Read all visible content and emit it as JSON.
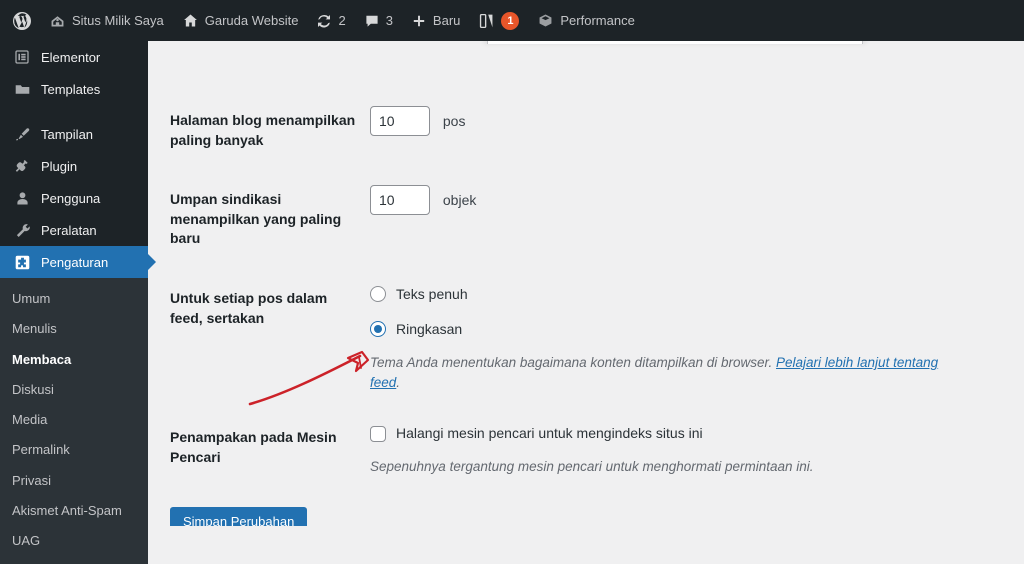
{
  "adminbar": {
    "items": [
      {
        "name": "wp-logo",
        "icon": "wordpress-icon",
        "label": ""
      },
      {
        "name": "my-site",
        "icon": "site-icon",
        "label": "Situs Milik Saya"
      },
      {
        "name": "site-name",
        "icon": "home-icon",
        "label": "Garuda Website"
      },
      {
        "name": "updates",
        "icon": "update-icon",
        "label": "2"
      },
      {
        "name": "comments",
        "icon": "comment-icon",
        "label": "3"
      },
      {
        "name": "new-content",
        "icon": "plus-icon",
        "label": "Baru"
      },
      {
        "name": "yoast-seo",
        "icon": "yoast-icon",
        "label": "",
        "badge": "1"
      },
      {
        "name": "performance",
        "icon": "performance-icon",
        "label": "Performance"
      }
    ]
  },
  "sidebar": {
    "top_items": [
      {
        "label": "Elementor",
        "icon": "elementor-icon",
        "current": false
      },
      {
        "label": "Templates",
        "icon": "folder-icon",
        "current": false
      },
      {
        "label": "Tampilan",
        "icon": "appearance-brush-icon",
        "current": false
      },
      {
        "label": "Plugin",
        "icon": "plugin-icon",
        "current": false
      },
      {
        "label": "Pengguna",
        "icon": "users-icon",
        "current": false
      },
      {
        "label": "Peralatan",
        "icon": "tools-wrench-icon",
        "current": false
      },
      {
        "label": "Pengaturan",
        "icon": "settings-gear-icon",
        "current": true
      }
    ],
    "submenu": [
      {
        "label": "Umum",
        "current": false
      },
      {
        "label": "Menulis",
        "current": false
      },
      {
        "label": "Membaca",
        "current": true
      },
      {
        "label": "Diskusi",
        "current": false
      },
      {
        "label": "Media",
        "current": false
      },
      {
        "label": "Permalink",
        "current": false
      },
      {
        "label": "Privasi",
        "current": false
      },
      {
        "label": "Akismet Anti-Spam",
        "current": false
      },
      {
        "label": "UAG",
        "current": false
      }
    ]
  },
  "form": {
    "posts_per_page": {
      "label": "Halaman blog menampilkan paling banyak",
      "value": "10",
      "unit": "pos"
    },
    "posts_per_rss": {
      "label": "Umpan sindikasi menampilkan yang paling baru",
      "value": "10",
      "unit": "objek"
    },
    "feed_content": {
      "label": "Untuk setiap pos dalam feed, sertakan",
      "option_full": "Teks penuh",
      "option_summary": "Ringkasan",
      "selected": "summary",
      "description_text": "Tema Anda menentukan bagaimana konten ditampilkan di browser. ",
      "description_link": "Pelajari lebih lanjut tentang feed",
      "description_suffix": "."
    },
    "search_visibility": {
      "label": "Penampakan pada Mesin Pencari",
      "checkbox_label": "Halangi mesin pencari untuk mengindeks situs ini",
      "checked": false,
      "description": "Sepenuhnya tergantung mesin pencari untuk menghormati permintaan ini."
    },
    "submit_label": "Simpan Perubahan"
  },
  "annotation": {
    "type": "arrow",
    "color": "#cc2229",
    "points_to": "search-visibility-checkbox"
  },
  "colors": {
    "admin_bar_bg": "#1d2327",
    "menu_bg": "#1d2327",
    "submenu_bg": "#2c3338",
    "accent_blue": "#2271b1",
    "content_bg": "#f0f0f1",
    "badge_orange": "#e8562a",
    "annotation_red": "#cc2229"
  }
}
